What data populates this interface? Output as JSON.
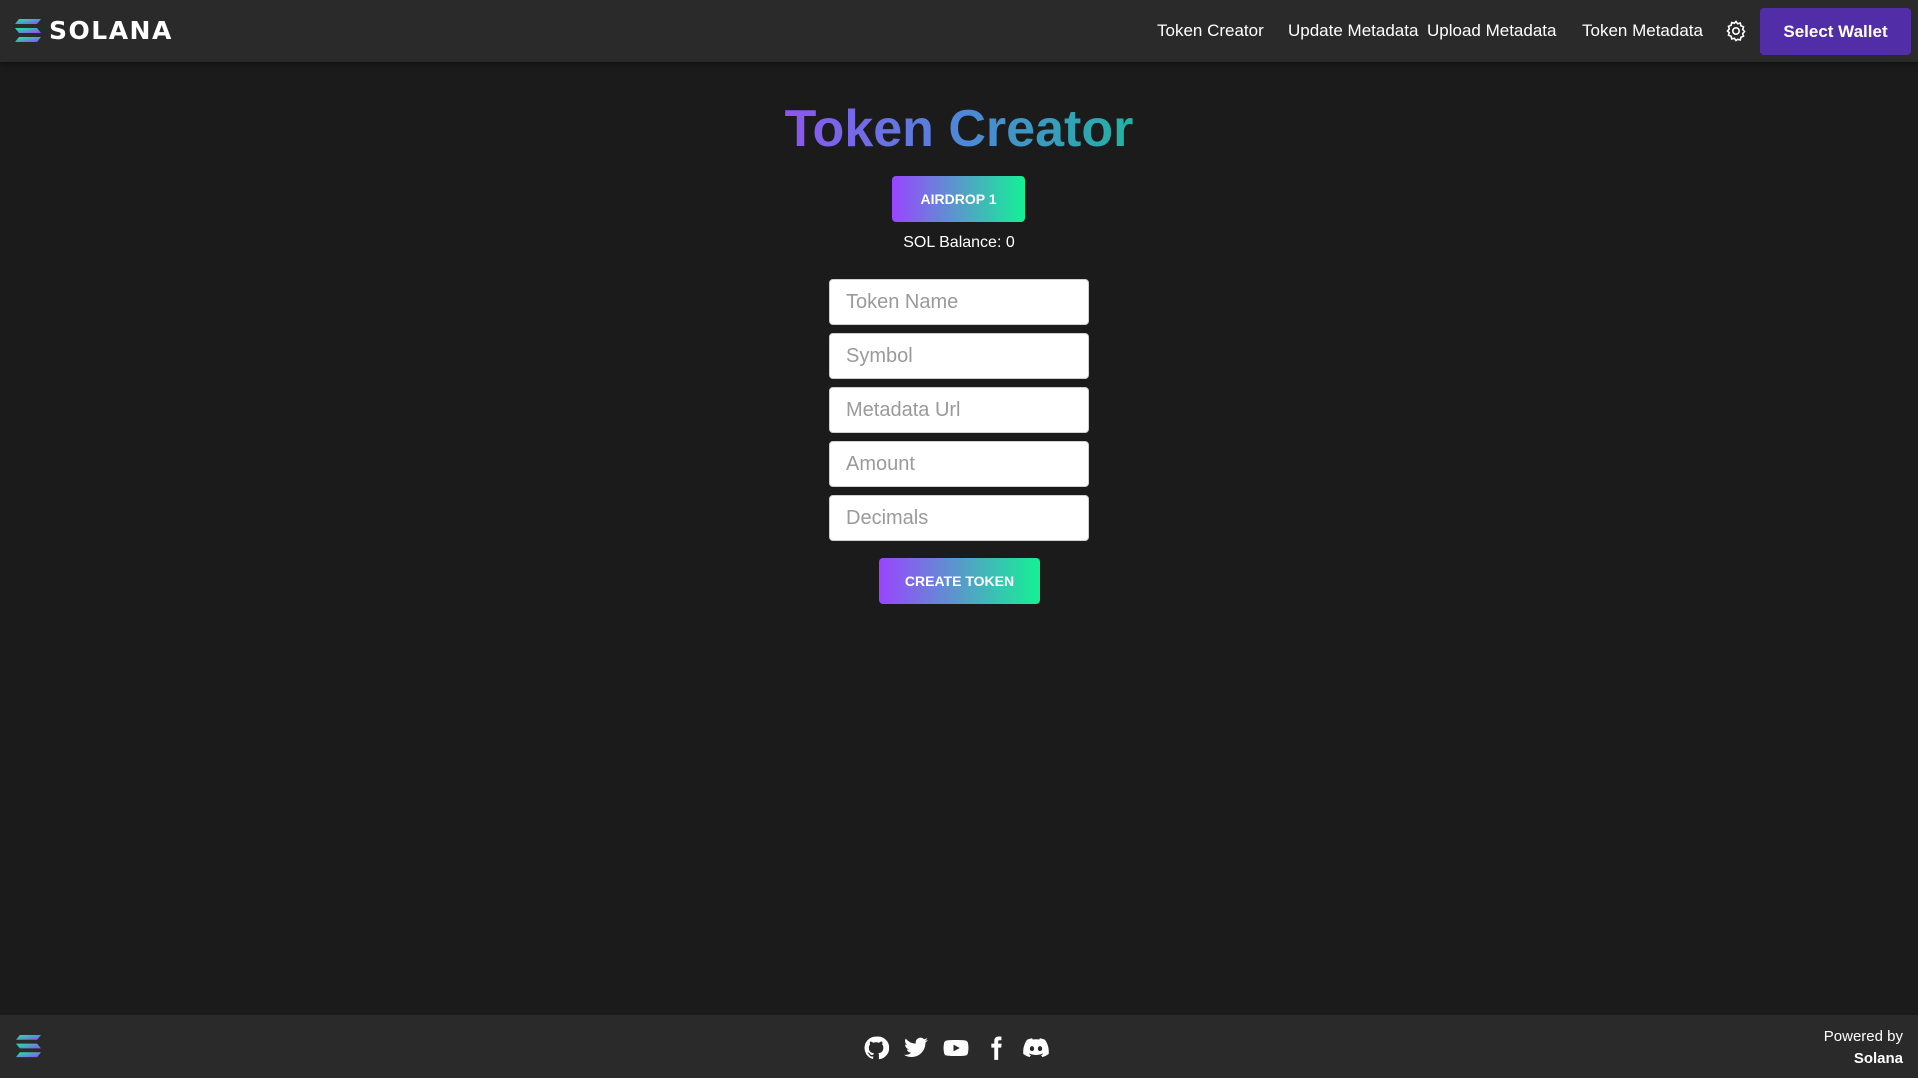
{
  "brand": {
    "name": "SOLANA",
    "logo_icon": "solana-logo-icon"
  },
  "nav": {
    "links": [
      "Token Creator",
      "Update Metadata",
      "Upload Metadata",
      "Token Metadata"
    ],
    "settings_icon": "gear-icon",
    "wallet_button": "Select Wallet"
  },
  "main": {
    "title": "Token Creator",
    "airdrop_button": "AIRDROP 1",
    "balance_text": "SOL Balance: 0",
    "fields": [
      {
        "placeholder": "Token Name",
        "value": ""
      },
      {
        "placeholder": "Symbol",
        "value": ""
      },
      {
        "placeholder": "Metadata Url",
        "value": ""
      },
      {
        "placeholder": "Amount",
        "value": ""
      },
      {
        "placeholder": "Decimals",
        "value": ""
      }
    ],
    "create_button": "CREATE TOKEN"
  },
  "footer": {
    "logo_icon": "solana-logo-icon",
    "social_icons": [
      "github-icon",
      "twitter-icon",
      "youtube-icon",
      "facebook-icon",
      "discord-icon"
    ],
    "powered_by": "Powered by",
    "powered_name": "Solana"
  },
  "colors": {
    "background": "#1b1b1b",
    "navbar": "#2a2a2a",
    "wallet_button": "#512da8",
    "gradient_start": "#9945ff",
    "gradient_end": "#14f195"
  }
}
